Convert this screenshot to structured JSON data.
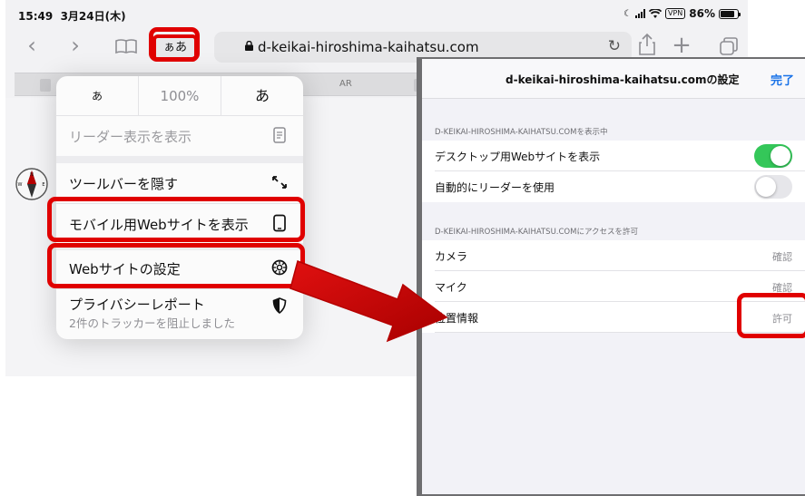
{
  "status_bar": {
    "time": "15:49",
    "date": "3月24日(木)",
    "vpn": "VPN",
    "battery": "86%",
    "battery_level": 0.86
  },
  "toolbar": {
    "reader_text_button": "ぁあ",
    "url": "d-keikai-hiroshima-kaihatsu.com",
    "icons": [
      "chevron-left-icon",
      "chevron-right-icon",
      "book-icon",
      "lock-icon",
      "reload-icon",
      "share-icon",
      "plus-icon",
      "tabs-icon"
    ]
  },
  "tabstrip": {
    "tab_label": "AR"
  },
  "menu": {
    "font_small": "あ",
    "zoom": "100%",
    "font_large": "あ",
    "items": [
      {
        "label": "リーダー表示を表示",
        "icon": "reader-icon",
        "enabled": false
      },
      {
        "label": "ツールバーを隠す",
        "icon": "resize-arrows-icon",
        "enabled": true
      },
      {
        "label": "モバイル用Webサイトを表示",
        "icon": "phone-icon",
        "enabled": true
      },
      {
        "label": "Webサイトの設定",
        "icon": "gear-icon",
        "enabled": true
      },
      {
        "label": "プライバシーレポート",
        "sub": "2件のトラッカーを阻止しました",
        "icon": "shield-icon",
        "enabled": true
      }
    ]
  },
  "settings": {
    "title": "d-keikai-hiroshima-kaihatsu.comの設定",
    "done": "完了",
    "section1_header": "D-KEIKAI-HIROSHIMA-KAIHATSU.COMを表示中",
    "section1_rows": [
      {
        "label": "デスクトップ用Webサイトを表示",
        "on": true
      },
      {
        "label": "自動的にリーダーを使用",
        "on": false
      }
    ],
    "section2_header": "D-KEIKAI-HIROSHIMA-KAIHATSU.COMにアクセスを許可",
    "section2_rows": [
      {
        "label": "カメラ",
        "value": "確認"
      },
      {
        "label": "マイク",
        "value": "確認"
      },
      {
        "label": "位置情報",
        "value": "許可"
      }
    ]
  },
  "colors": {
    "highlight": "#e00000",
    "toggle_on": "#34c759",
    "link": "#1a73e8"
  }
}
